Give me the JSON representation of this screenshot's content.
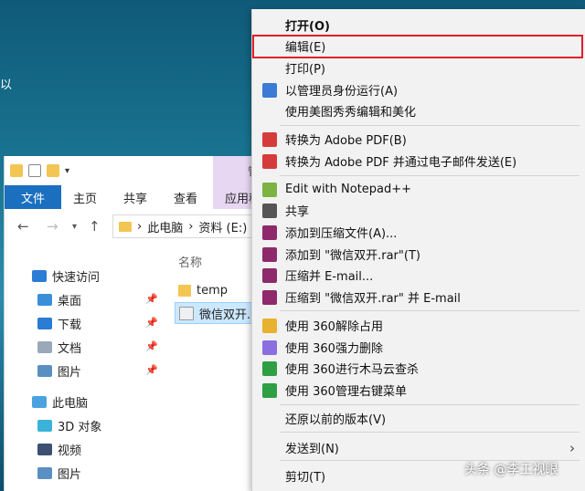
{
  "explorer": {
    "ribbon": {
      "file": "文件",
      "home": "主页",
      "share": "共享",
      "view": "查看",
      "app_tools": "应用程"
    },
    "qat_context_label": "管",
    "address": {
      "pc": "此电脑",
      "drive": "资料 (E:)",
      "sep": "›"
    },
    "nav": [
      {
        "label": "快速访问",
        "icon": "star-icon",
        "color": "#2b7cd3"
      },
      {
        "label": "桌面",
        "icon": "desktop-icon",
        "color": "#3a8fd8",
        "pinned": true
      },
      {
        "label": "下载",
        "icon": "download-icon",
        "color": "#2b7cd3",
        "pinned": true
      },
      {
        "label": "文档",
        "icon": "document-icon",
        "color": "#9aa8b8",
        "pinned": true
      },
      {
        "label": "图片",
        "icon": "picture-icon",
        "color": "#5a8fc2",
        "pinned": true
      },
      {
        "label": "此电脑",
        "icon": "computer-icon",
        "color": "#4aa3df"
      },
      {
        "label": "3D 对象",
        "icon": "cube-icon",
        "color": "#3bb3d8"
      },
      {
        "label": "视频",
        "icon": "video-icon",
        "color": "#3d4f73"
      },
      {
        "label": "图片",
        "icon": "picture-icon",
        "color": "#5a8fc2"
      }
    ],
    "column_name": "名称",
    "files": [
      {
        "name": "temp",
        "icon": "folder-icon"
      },
      {
        "name": "微信双开.b",
        "icon": "script-file-icon"
      }
    ]
  },
  "menu": {
    "items": [
      {
        "label": "打开(O)",
        "bold": true
      },
      {
        "label": "编辑(E)",
        "highlighted": true
      },
      {
        "label": "打印(P)"
      },
      {
        "label": "以管理员身份运行(A)",
        "icon": "shield-icon"
      },
      {
        "label": "使用美图秀秀编辑和美化"
      },
      {
        "label": "转换为 Adobe PDF(B)",
        "icon": "pdf-icon"
      },
      {
        "label": "转换为 Adobe PDF 并通过电子邮件发送(E)",
        "icon": "pdf-mail-icon"
      },
      {
        "label": "Edit with Notepad++",
        "icon": "notepad-icon"
      },
      {
        "label": "共享",
        "icon": "share-icon"
      },
      {
        "label": "添加到压缩文件(A)...",
        "icon": "winrar-icon"
      },
      {
        "label": "添加到 \"微信双开.rar\"(T)",
        "icon": "winrar-icon"
      },
      {
        "label": "压缩并 E-mail...",
        "icon": "winrar-icon"
      },
      {
        "label": "压缩到 \"微信双开.rar\" 并 E-mail",
        "icon": "winrar-icon"
      },
      {
        "label": "使用 360解除占用",
        "icon": "unlock-360-icon"
      },
      {
        "label": "使用 360强力删除",
        "icon": "delete-360-icon"
      },
      {
        "label": "使用 360进行木马云查杀",
        "icon": "scan-360-icon"
      },
      {
        "label": "使用 360管理右键菜单",
        "icon": "menu-360-icon"
      },
      {
        "label": "还原以前的版本(V)"
      },
      {
        "label": "发送到(N)",
        "submenu": true
      },
      {
        "label": "剪切(T)"
      }
    ]
  },
  "watermark": "头条 @李工视眼",
  "colors": {
    "highlight_border": "#e0202a",
    "ribbon_file": "#1a6fbf",
    "menu_bg": "#f2f2f2"
  }
}
